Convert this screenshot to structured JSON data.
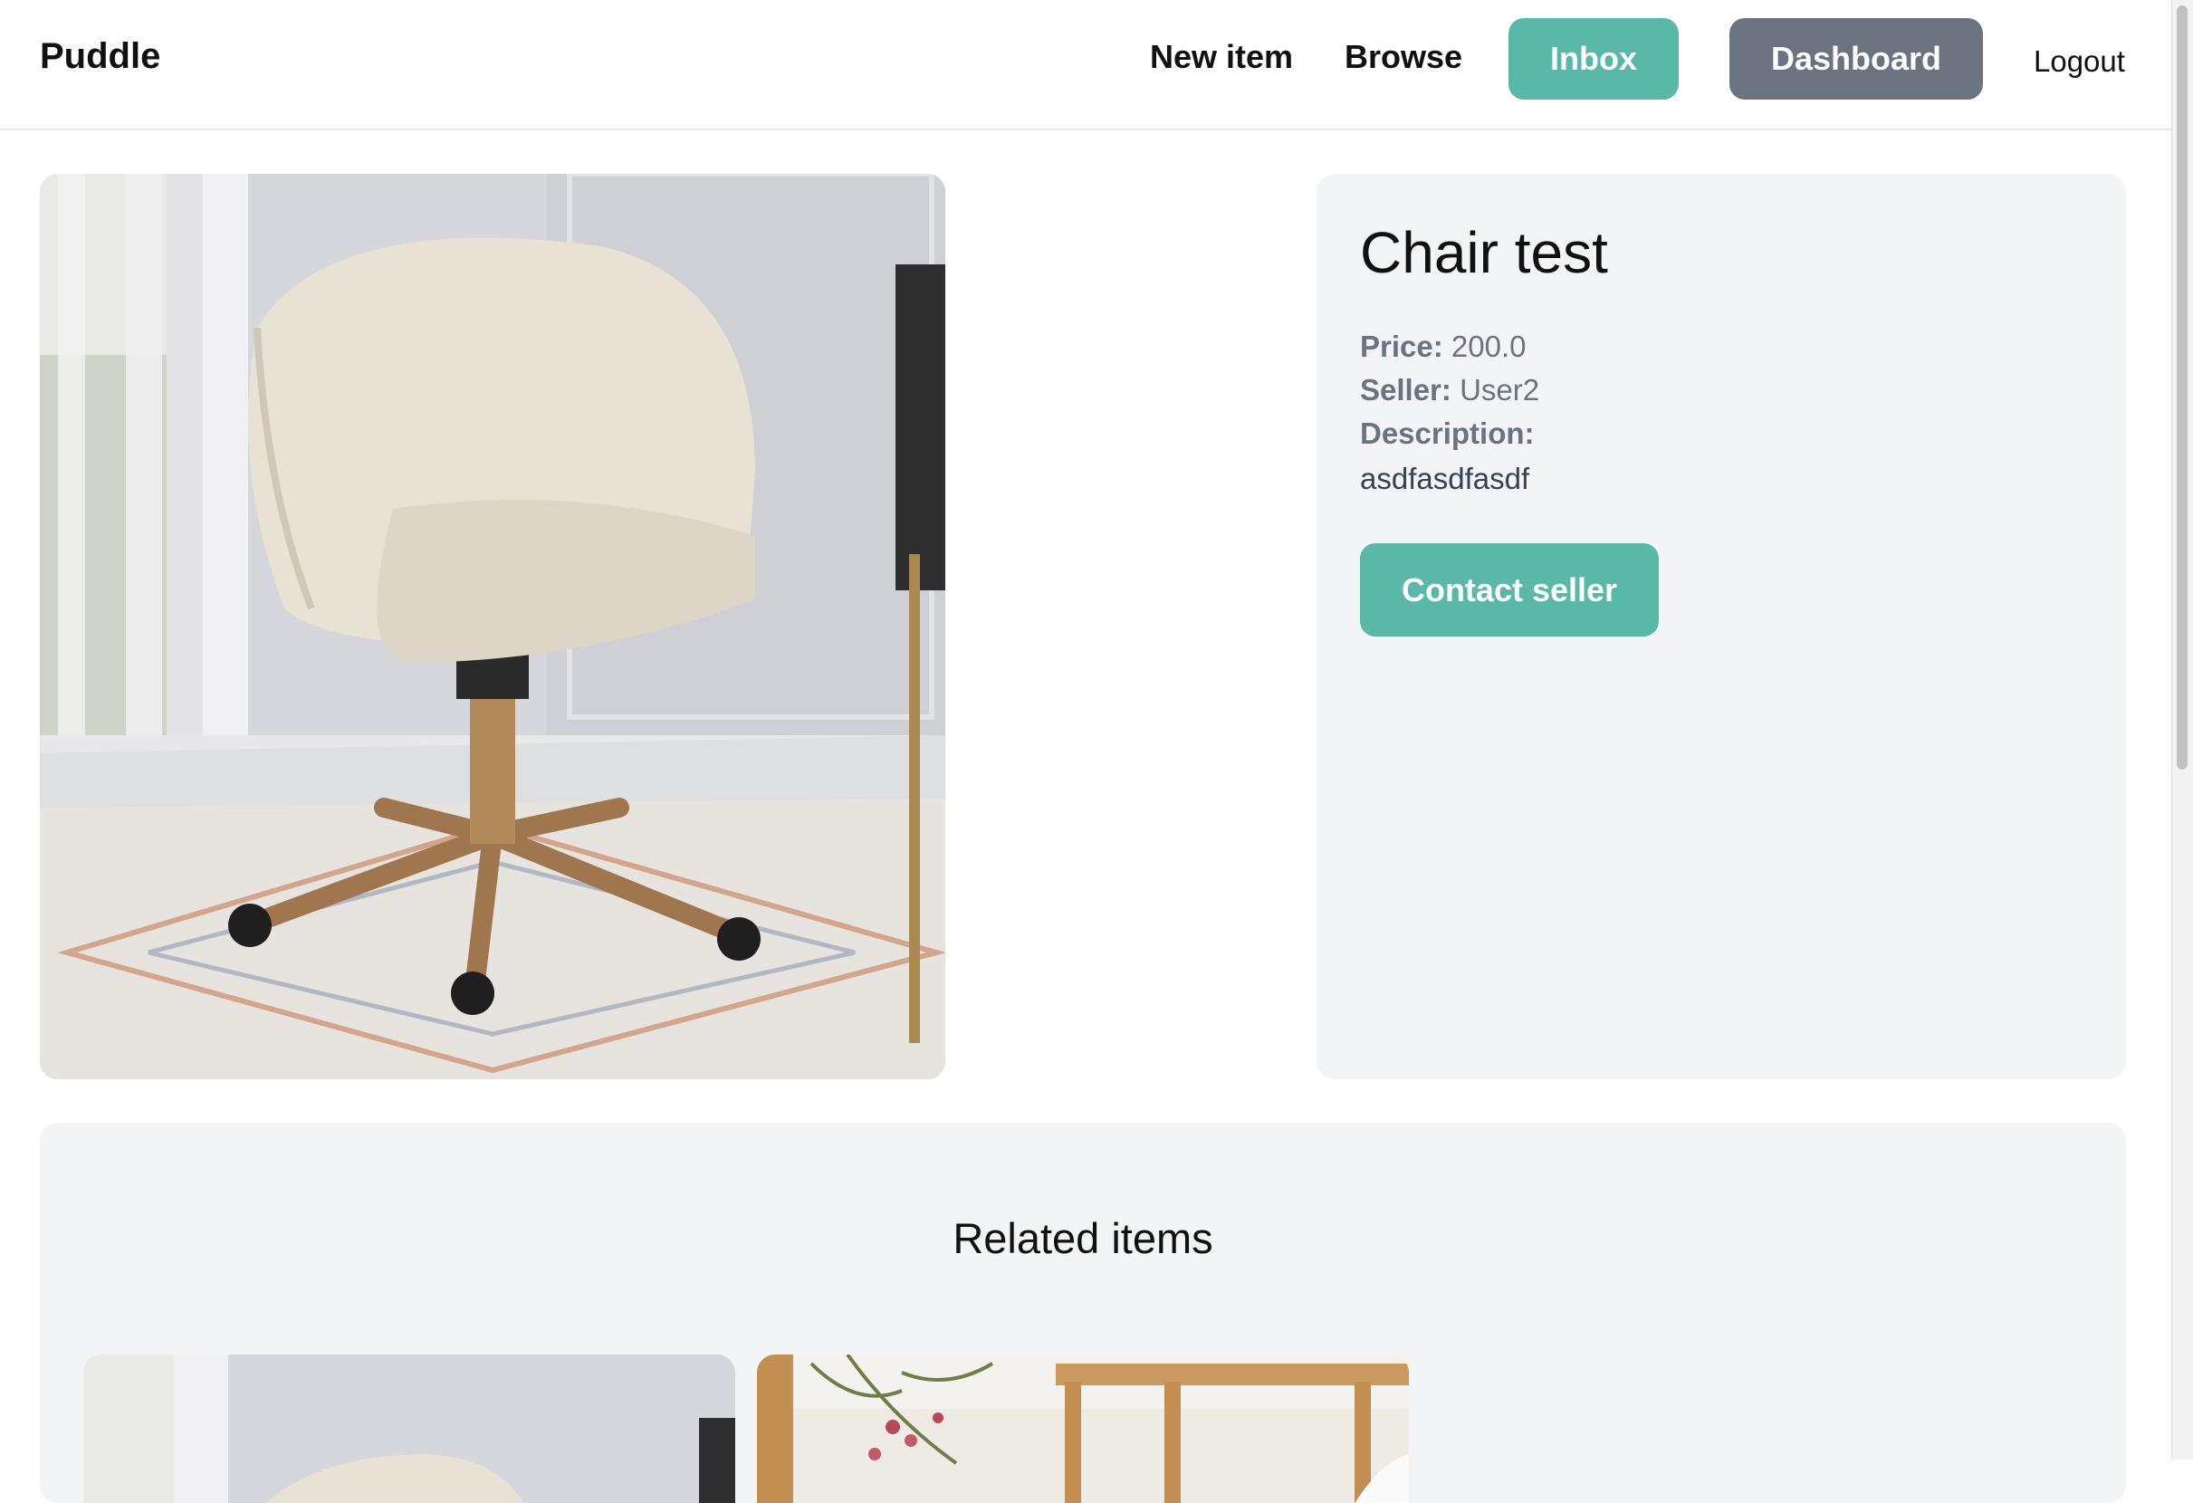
{
  "nav": {
    "logo": "Puddle",
    "new_item": "New item",
    "browse": "Browse",
    "inbox": "Inbox",
    "dashboard": "Dashboard",
    "logout": "Logout"
  },
  "item": {
    "title": "Chair test",
    "price_label": "Price:",
    "price": "200.0",
    "seller_label": "Seller:",
    "seller": "User2",
    "description_label": "Description:",
    "description": "asdfasdfasdf",
    "contact_button": "Contact seller"
  },
  "related": {
    "title": "Related items"
  },
  "colors": {
    "teal": "#59b8a8",
    "slate": "#6b7280",
    "panel": "#f3f4f6"
  }
}
